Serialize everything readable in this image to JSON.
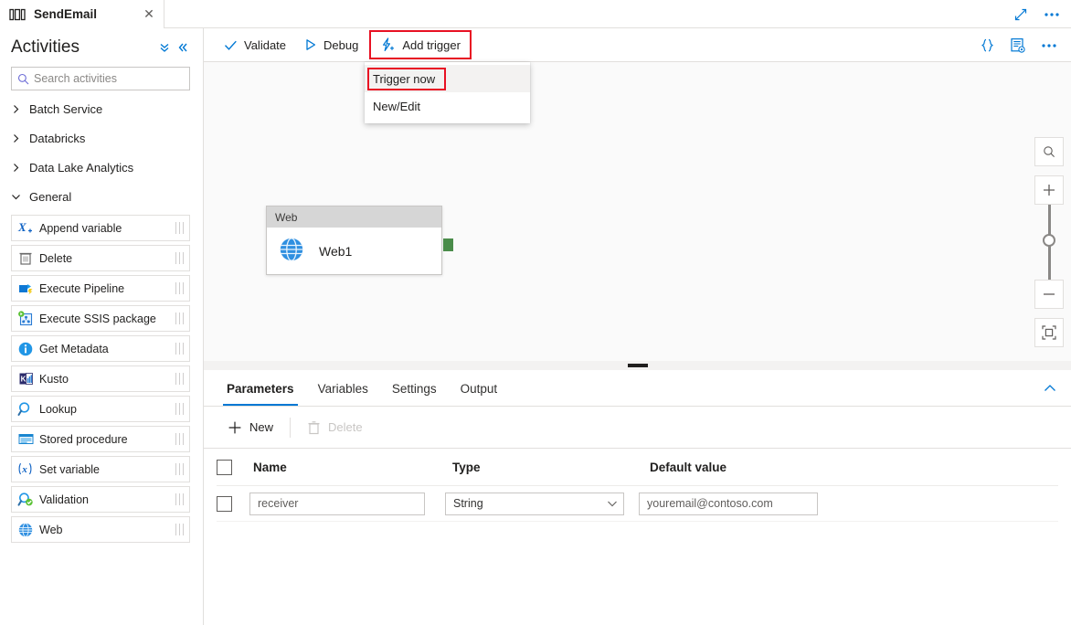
{
  "tab": {
    "title": "SendEmail",
    "icon": "pipeline-icon",
    "close": "✕"
  },
  "window": {
    "expand_icon": "expand-diagonal-icon",
    "more_icon": "ellipsis-icon"
  },
  "sidebar": {
    "title": "Activities",
    "collapse_all_icon": "double-chevron-down-icon",
    "collapse_panel_icon": "double-chevron-left-icon",
    "search": {
      "placeholder": "Search activities",
      "value": "",
      "icon": "search-icon"
    },
    "categories": [
      {
        "label": "Batch Service",
        "expanded": false
      },
      {
        "label": "Databricks",
        "expanded": false
      },
      {
        "label": "Data Lake Analytics",
        "expanded": false
      },
      {
        "label": "General",
        "expanded": true
      }
    ],
    "activities": [
      {
        "label": "Append variable",
        "icon": "append-variable-icon"
      },
      {
        "label": "Delete",
        "icon": "trash-icon"
      },
      {
        "label": "Execute Pipeline",
        "icon": "execute-pipeline-icon"
      },
      {
        "label": "Execute SSIS package",
        "icon": "ssis-package-icon"
      },
      {
        "label": "Get Metadata",
        "icon": "info-icon"
      },
      {
        "label": "Kusto",
        "icon": "kusto-icon"
      },
      {
        "label": "Lookup",
        "icon": "magnifier-icon"
      },
      {
        "label": "Stored procedure",
        "icon": "stored-procedure-icon"
      },
      {
        "label": "Set variable",
        "icon": "set-variable-icon"
      },
      {
        "label": "Validation",
        "icon": "validation-icon"
      },
      {
        "label": "Web",
        "icon": "globe-icon"
      }
    ]
  },
  "toolbar": {
    "validate": {
      "label": "Validate",
      "icon": "checkmark-icon"
    },
    "debug": {
      "label": "Debug",
      "icon": "play-icon"
    },
    "add_trigger": {
      "label": "Add trigger",
      "icon": "lightning-bolt-plus-icon",
      "highlighted": true
    },
    "code_icon": "curly-braces-icon",
    "properties_icon": "properties-list-icon",
    "more_icon": "ellipsis-icon"
  },
  "trigger_menu": {
    "open": true,
    "items": [
      {
        "label": "Trigger now",
        "hovered": true,
        "highlighted": true
      },
      {
        "label": "New/Edit",
        "hovered": false,
        "highlighted": false
      }
    ]
  },
  "canvas": {
    "node": {
      "type_label": "Web",
      "name": "Web1",
      "icon": "globe-icon",
      "port_color": "#4a8c4a"
    },
    "zoom_controls": {
      "search_icon": "zoom-search-icon",
      "zoom_in_icon": "plus-icon",
      "zoom_out_icon": "minus-icon",
      "fit_icon": "fit-to-screen-icon"
    }
  },
  "panel": {
    "tabs": [
      {
        "label": "Parameters",
        "active": true
      },
      {
        "label": "Variables",
        "active": false
      },
      {
        "label": "Settings",
        "active": false
      },
      {
        "label": "Output",
        "active": false
      }
    ],
    "collapse_icon": "chevron-up-icon",
    "commands": {
      "new": {
        "label": "New",
        "icon": "plus-icon",
        "disabled": false
      },
      "delete": {
        "label": "Delete",
        "icon": "trash-icon",
        "disabled": true
      }
    },
    "table": {
      "headers": [
        "Name",
        "Type",
        "Default value"
      ],
      "rows": [
        {
          "selected": false,
          "name": "receiver",
          "type": "String",
          "default_value": "youremail@contoso.com"
        }
      ]
    }
  },
  "colors": {
    "accent": "#0078d4",
    "highlight": "#e81123",
    "success": "#4a8c4a"
  }
}
